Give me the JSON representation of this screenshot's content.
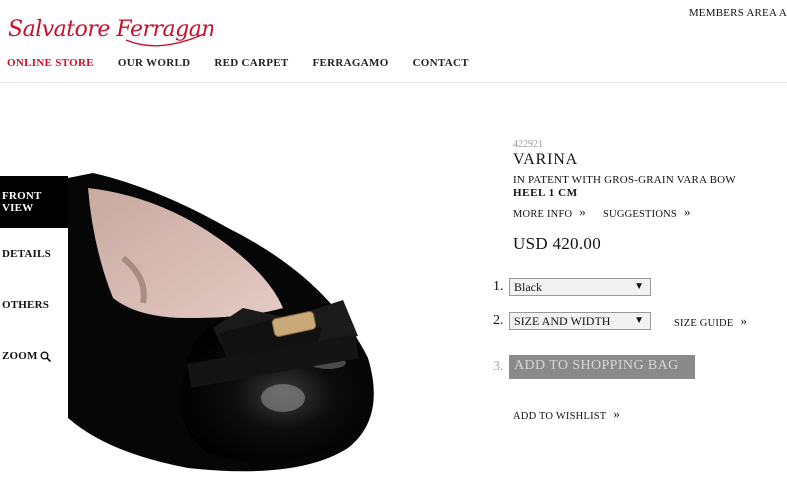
{
  "brand": {
    "logo_text": "Salvatore Ferragamo",
    "color": "#c8102e"
  },
  "header": {
    "members_area": "MEMBERS AREA A"
  },
  "nav": {
    "items": [
      "ONLINE STORE",
      "OUR WORLD",
      "RED CARPET",
      "FERRAGAMO",
      "CONTACT"
    ],
    "active": "ONLINE STORE"
  },
  "views": {
    "front": "FRONT VIEW",
    "details": "DETAILS",
    "others": "OTHERS",
    "zoom": "ZOOM",
    "zoom_icon": "magnifier-icon"
  },
  "product": {
    "sku": "422921",
    "name": "VARINA",
    "description": "IN PATENT WITH GROS-GRAIN VARA BOW",
    "heel": "HEEL 1 CM",
    "more_info": "MORE INFO",
    "suggestions": "SUGGESTIONS",
    "price": "USD 420.00"
  },
  "purchase": {
    "step1": "1.",
    "step2": "2.",
    "step3": "3.",
    "color_select": "Black",
    "size_select": "SIZE AND WIDTH",
    "size_guide": "SIZE GUIDE",
    "add_to_bag": "ADD TO SHOPPING BAG",
    "wishlist": "ADD TO WISHLIST"
  },
  "link_glyph": "»"
}
